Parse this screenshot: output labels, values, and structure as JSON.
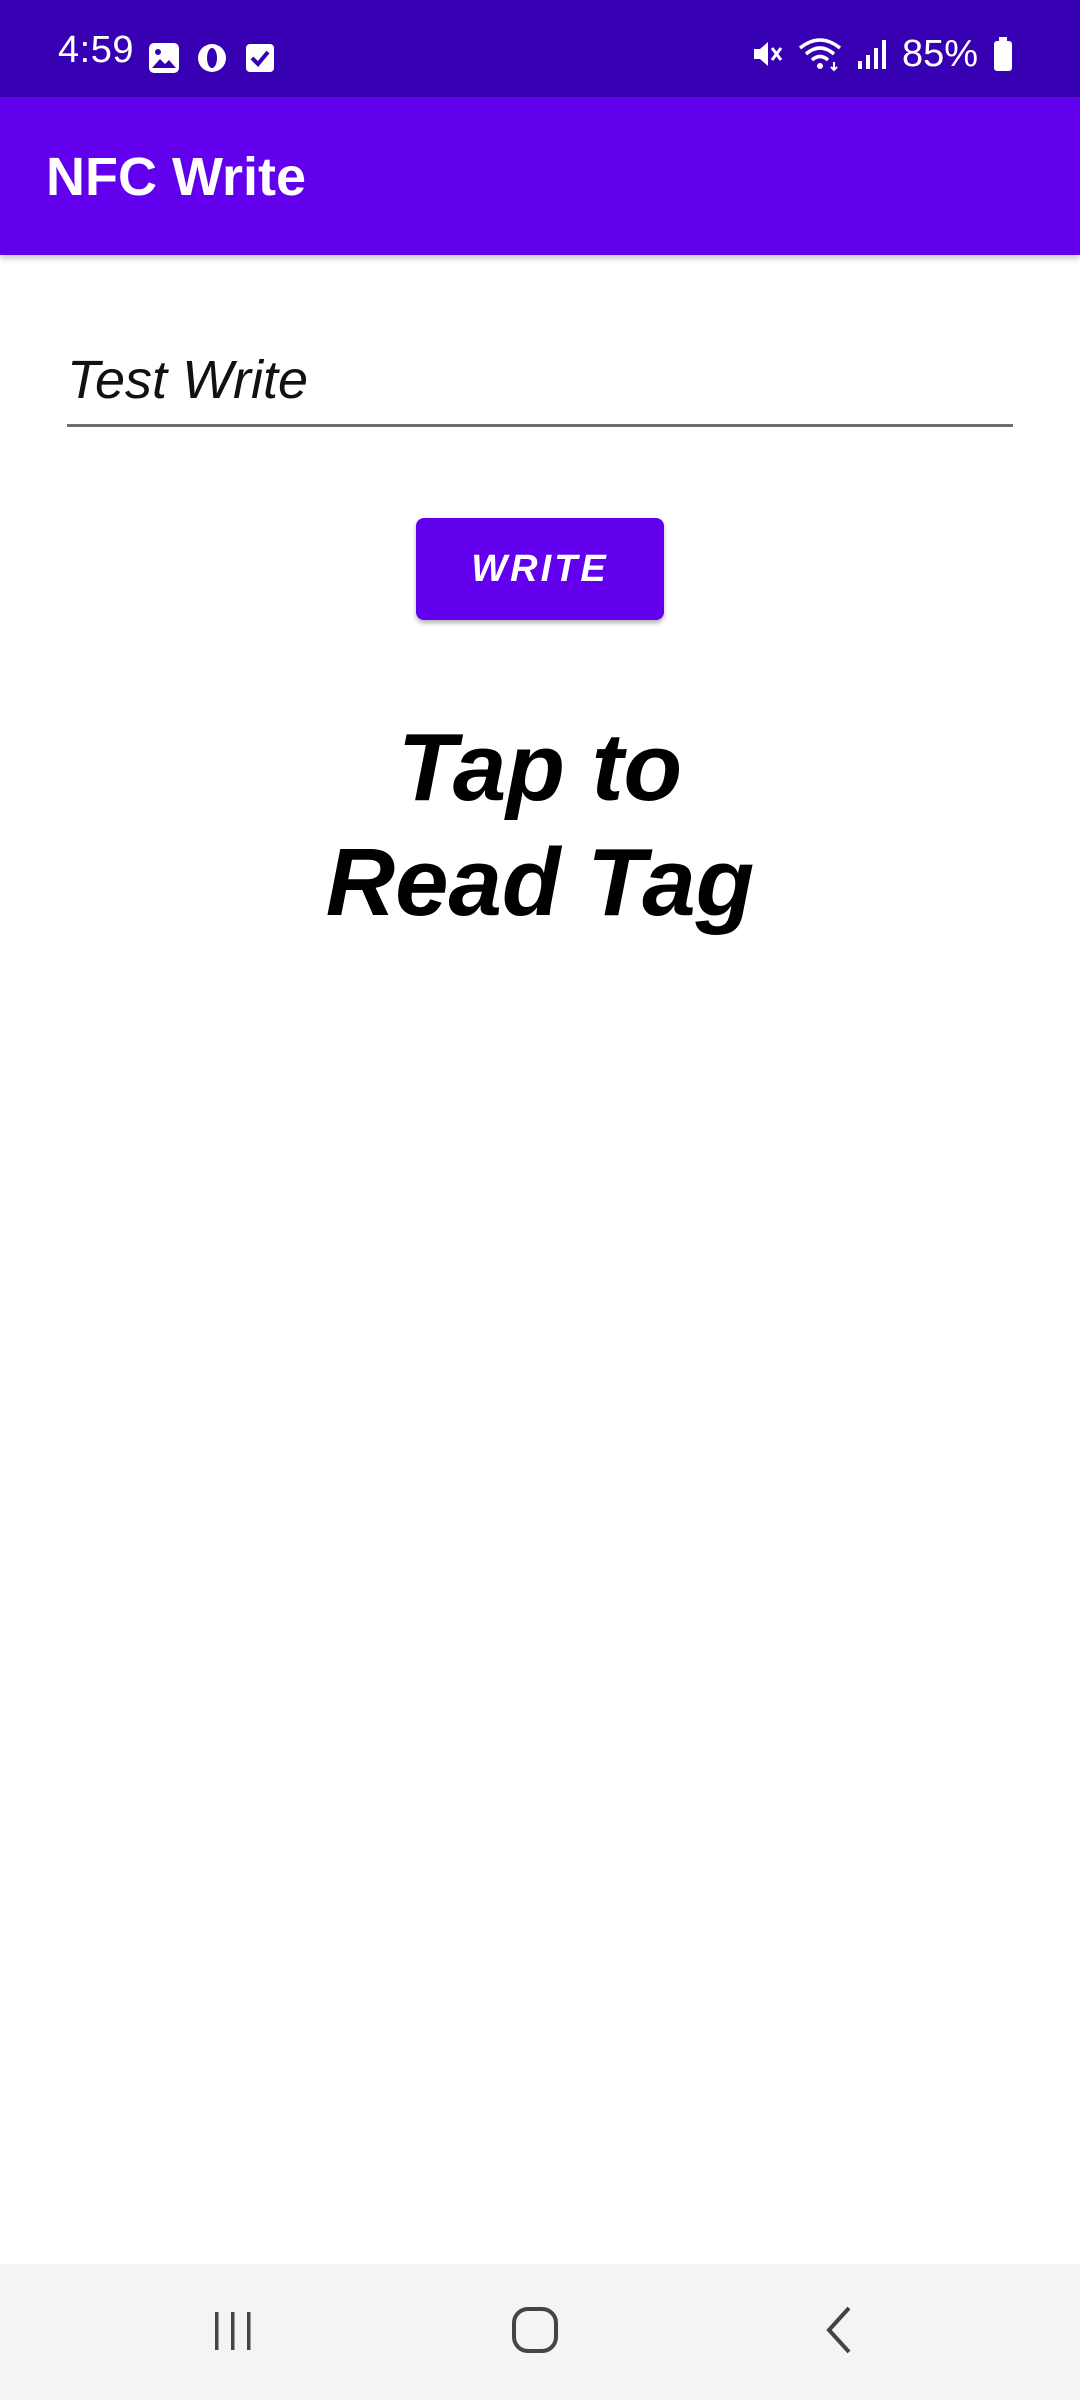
{
  "status_bar": {
    "time": "4:59",
    "battery": "85%",
    "left_icons": [
      "image-icon",
      "opera-icon",
      "checkbox-icon"
    ],
    "right_icons": [
      "mute-icon",
      "wifi-icon",
      "signal-icon",
      "battery-icon"
    ]
  },
  "app_bar": {
    "title": "NFC Write"
  },
  "form": {
    "input_value": "Test Write",
    "write_button_label": "WRITE"
  },
  "main": {
    "read_text_line1": "Tap to",
    "read_text_line2": "Read Tag"
  },
  "nav_bar": {
    "buttons": [
      "recent-apps-icon",
      "home-icon",
      "back-icon"
    ]
  },
  "colors": {
    "status_bar": "#3700b3",
    "primary": "#6200ee",
    "nav_bar": "#f4f4f4"
  }
}
